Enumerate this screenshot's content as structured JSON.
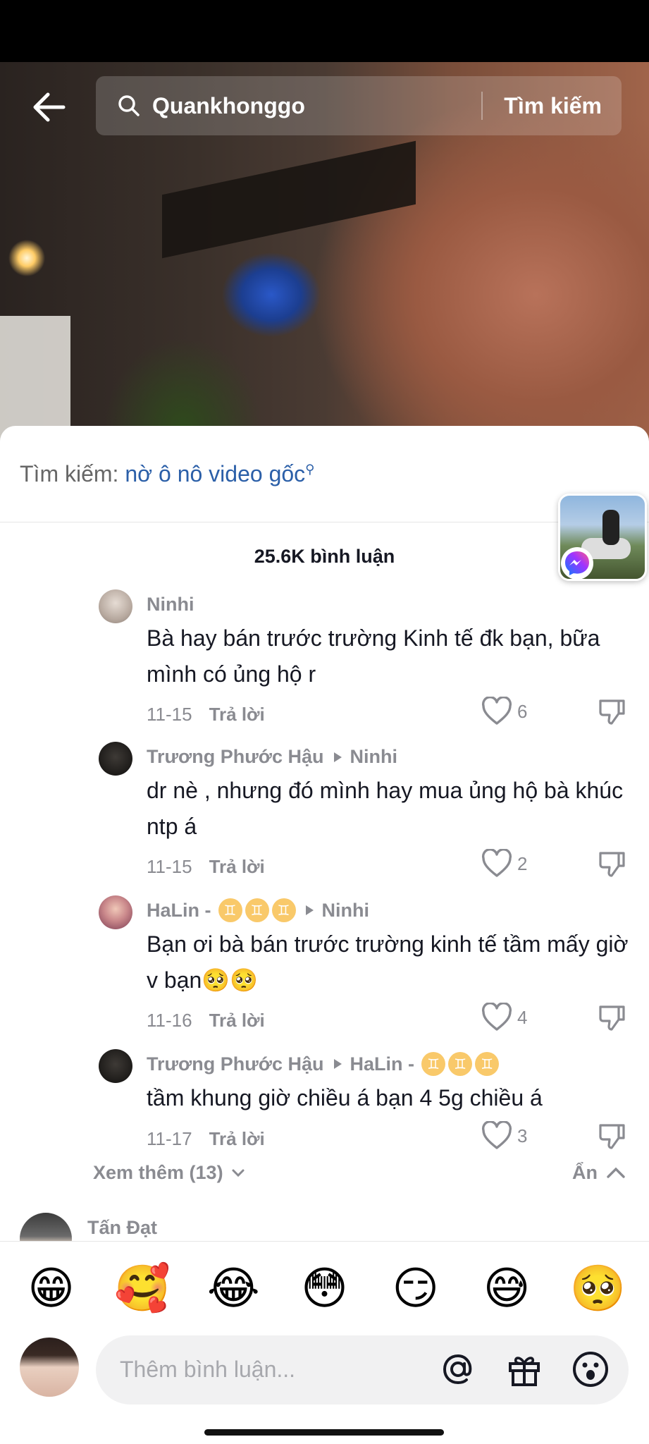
{
  "header": {
    "search_query": "Quankhonggo",
    "search_button": "Tìm kiếm"
  },
  "sheet": {
    "suggest_prefix": "Tìm kiếm:",
    "suggest_term": "nờ ô nô video gốc",
    "comment_count": "25.6K bình luận"
  },
  "comments": [
    {
      "author": "Ninhi",
      "reply_to": "",
      "text": "Bà hay bán trước trường Kinh tế đk bạn, bữa mình có ủng hộ r",
      "date": "11-15",
      "reply_label": "Trả lời",
      "likes": "6"
    },
    {
      "author": "Trương Phước Hậu",
      "reply_to": "Ninhi",
      "text": "dr nè , nhưng đó mình hay mua ủng hộ bà khúc ntp á",
      "date": "11-15",
      "reply_label": "Trả lời",
      "likes": "2"
    },
    {
      "author": "HaLin -",
      "reply_to": "Ninhi",
      "text": "Bạn ơi bà bán trước trường kinh tế tầm mấy giờ v bạn🥺🥺",
      "date": "11-16",
      "reply_label": "Trả lời",
      "likes": "4"
    },
    {
      "author": "Trương Phước Hậu",
      "reply_to": "HaLin -",
      "text": "tầm khung giờ chiều á bạn 4 5g chiều á",
      "date": "11-17",
      "reply_label": "Trả lời",
      "likes": "3"
    }
  ],
  "thread": {
    "view_more": "Xem thêm (13)",
    "hide": "Ẩn"
  },
  "next_comment": {
    "author": "Tấn Đạt"
  },
  "composer": {
    "emojis": [
      "😁",
      "🥰",
      "😂",
      "😳",
      "😏",
      "😅",
      "🥺"
    ],
    "placeholder": "Thêm bình luận...",
    "icons": [
      "at-icon",
      "gift-icon",
      "emoji-icon"
    ]
  }
}
